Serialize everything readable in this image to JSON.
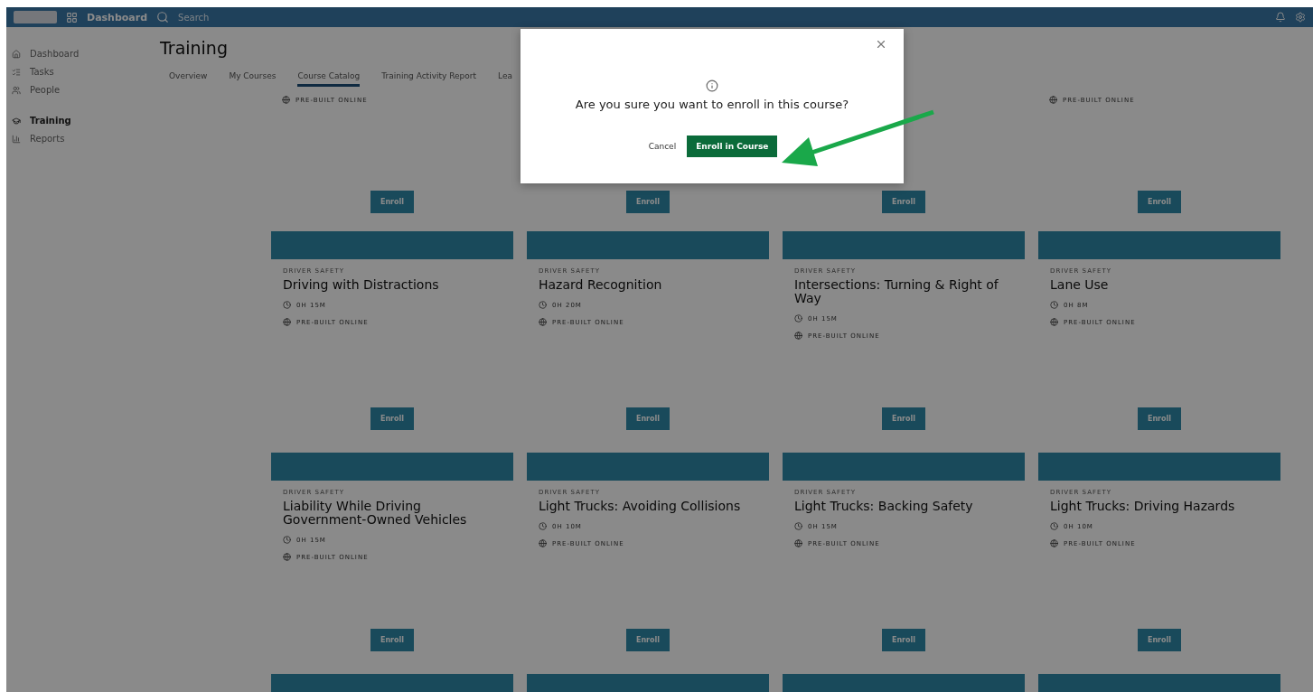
{
  "topbar": {
    "nav_label": "Dashboard",
    "search_placeholder": "Search"
  },
  "sidebar": {
    "items": [
      {
        "label": "Dashboard",
        "selected": false
      },
      {
        "label": "Tasks",
        "selected": false
      },
      {
        "label": "People",
        "selected": false
      },
      {
        "label": "Training",
        "selected": true
      },
      {
        "label": "Reports",
        "selected": false
      }
    ]
  },
  "page": {
    "title": "Training"
  },
  "tabs": [
    {
      "label": "Overview",
      "selected": false
    },
    {
      "label": "My Courses",
      "selected": false
    },
    {
      "label": "Course Catalog",
      "selected": true
    },
    {
      "label": "Training Activity Report",
      "selected": false
    },
    {
      "label": "Lea",
      "selected": false
    }
  ],
  "partial_cards": [
    {
      "format": "PRE-BUILT ONLINE",
      "button": "Enroll"
    },
    {
      "button": "Enroll"
    },
    {
      "button": "Enroll"
    },
    {
      "format": "PRE-BUILT ONLINE",
      "button": "Enroll"
    }
  ],
  "cards": [
    {
      "category": "DRIVER SAFETY",
      "title": "Driving with Distractions",
      "duration": "0H 15M",
      "format": "PRE-BUILT ONLINE",
      "button": "Enroll"
    },
    {
      "category": "DRIVER SAFETY",
      "title": "Hazard Recognition",
      "duration": "0H 20M",
      "format": "PRE-BUILT ONLINE",
      "button": "Enroll"
    },
    {
      "category": "DRIVER SAFETY",
      "title": "Intersections: Turning & Right of Way",
      "duration": "0H 15M",
      "format": "PRE-BUILT ONLINE",
      "button": "Enroll"
    },
    {
      "category": "DRIVER SAFETY",
      "title": "Lane Use",
      "duration": "0H 8M",
      "format": "PRE-BUILT ONLINE",
      "button": "Enroll"
    },
    {
      "category": "DRIVER SAFETY",
      "title": "Liability While Driving Government-Owned Vehicles",
      "duration": "0H 15M",
      "format": "PRE-BUILT ONLINE",
      "button": "Enroll"
    },
    {
      "category": "DRIVER SAFETY",
      "title": "Light Trucks: Avoiding Collisions",
      "duration": "0H 10M",
      "format": "PRE-BUILT ONLINE",
      "button": "Enroll"
    },
    {
      "category": "DRIVER SAFETY",
      "title": "Light Trucks: Backing Safety",
      "duration": "0H 15M",
      "format": "PRE-BUILT ONLINE",
      "button": "Enroll"
    },
    {
      "category": "DRIVER SAFETY",
      "title": "Light Trucks: Driving Hazards",
      "duration": "0H 10M",
      "format": "PRE-BUILT ONLINE",
      "button": "Enroll"
    }
  ],
  "modal": {
    "message": "Are you sure you want to enroll in this course?",
    "cancel": "Cancel",
    "confirm": "Enroll in Course"
  }
}
